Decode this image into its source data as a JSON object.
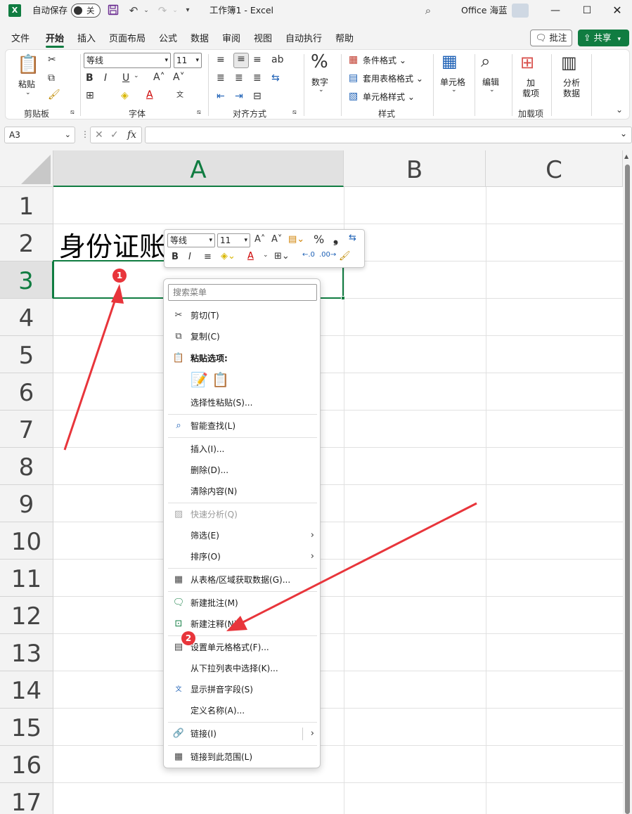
{
  "titlebar": {
    "autosave_label": "自动保存",
    "autosave_state": "关",
    "doc_title": "工作簿1 - Excel",
    "user_name": "Office 海蓝",
    "app_icon": "X"
  },
  "tabs": [
    "文件",
    "开始",
    "插入",
    "页面布局",
    "公式",
    "数据",
    "审阅",
    "视图",
    "自动执行",
    "帮助"
  ],
  "actions": {
    "comment": "批注",
    "share": "共享"
  },
  "ribbon": {
    "clipboard": {
      "paste": "粘贴",
      "group": "剪贴板"
    },
    "font": {
      "font_name": "等线",
      "font_size": "11",
      "group": "字体"
    },
    "alignment": {
      "group": "对齐方式"
    },
    "number": {
      "label": "数字"
    },
    "styles": {
      "conditional": "条件格式",
      "table": "套用表格格式",
      "cell_styles": "单元格样式",
      "group": "样式"
    },
    "cells": {
      "label": "单元格"
    },
    "editing": {
      "label": "编辑"
    },
    "addins": {
      "label_line1": "加",
      "label_line2": "载项",
      "group": "加载项"
    },
    "analyze": {
      "label_line1": "分析",
      "label_line2": "数据"
    }
  },
  "formula_bar": {
    "name_box": "A3",
    "fx": "fx",
    "value": ""
  },
  "sheet": {
    "columns": [
      "A",
      "B",
      "C"
    ],
    "selected_column": "A",
    "rows": [
      "1",
      "2",
      "3",
      "4",
      "5",
      "6",
      "7",
      "8",
      "9",
      "10",
      "11",
      "12",
      "13",
      "14",
      "15",
      "16",
      "17"
    ],
    "selected_row": "3",
    "cell_a2": "身份证账"
  },
  "mini_toolbar": {
    "font_name": "等线",
    "font_size": "11"
  },
  "context_menu": {
    "search_placeholder": "搜索菜单",
    "items": [
      {
        "label": "剪切(T)",
        "icon": "scissors-icon"
      },
      {
        "label": "复制(C)",
        "icon": "copy-icon"
      },
      {
        "label": "粘贴选项:",
        "icon": "paste-icon"
      },
      {
        "label": "选择性粘贴(S)...",
        "icon": ""
      },
      {
        "label": "智能查找(L)",
        "icon": "search-icon"
      },
      {
        "label": "插入(I)...",
        "icon": ""
      },
      {
        "label": "删除(D)...",
        "icon": ""
      },
      {
        "label": "清除内容(N)",
        "icon": ""
      },
      {
        "label": "快速分析(Q)",
        "icon": "quick-analysis-icon",
        "disabled": true
      },
      {
        "label": "筛选(E)",
        "icon": "",
        "submenu": true
      },
      {
        "label": "排序(O)",
        "icon": "",
        "submenu": true
      },
      {
        "label": "从表格/区域获取数据(G)...",
        "icon": "table-icon"
      },
      {
        "label": "新建批注(M)",
        "icon": "comment-icon"
      },
      {
        "label": "新建注释(N)",
        "icon": "note-icon"
      },
      {
        "label": "设置单元格格式(F)...",
        "icon": "format-cells-icon"
      },
      {
        "label": "从下拉列表中选择(K)...",
        "icon": ""
      },
      {
        "label": "显示拼音字段(S)",
        "icon": "phonetic-icon"
      },
      {
        "label": "定义名称(A)...",
        "icon": ""
      },
      {
        "label": "链接(I)",
        "icon": "link-icon",
        "submenu": true
      },
      {
        "label": "链接到此范围(L)",
        "icon": "link-range-icon"
      }
    ]
  },
  "annotations": {
    "badge1": "1",
    "badge2": "2",
    "arrow_color": "#e8353b"
  },
  "colors": {
    "accent": "#107c41",
    "annotation": "#e8353b"
  }
}
